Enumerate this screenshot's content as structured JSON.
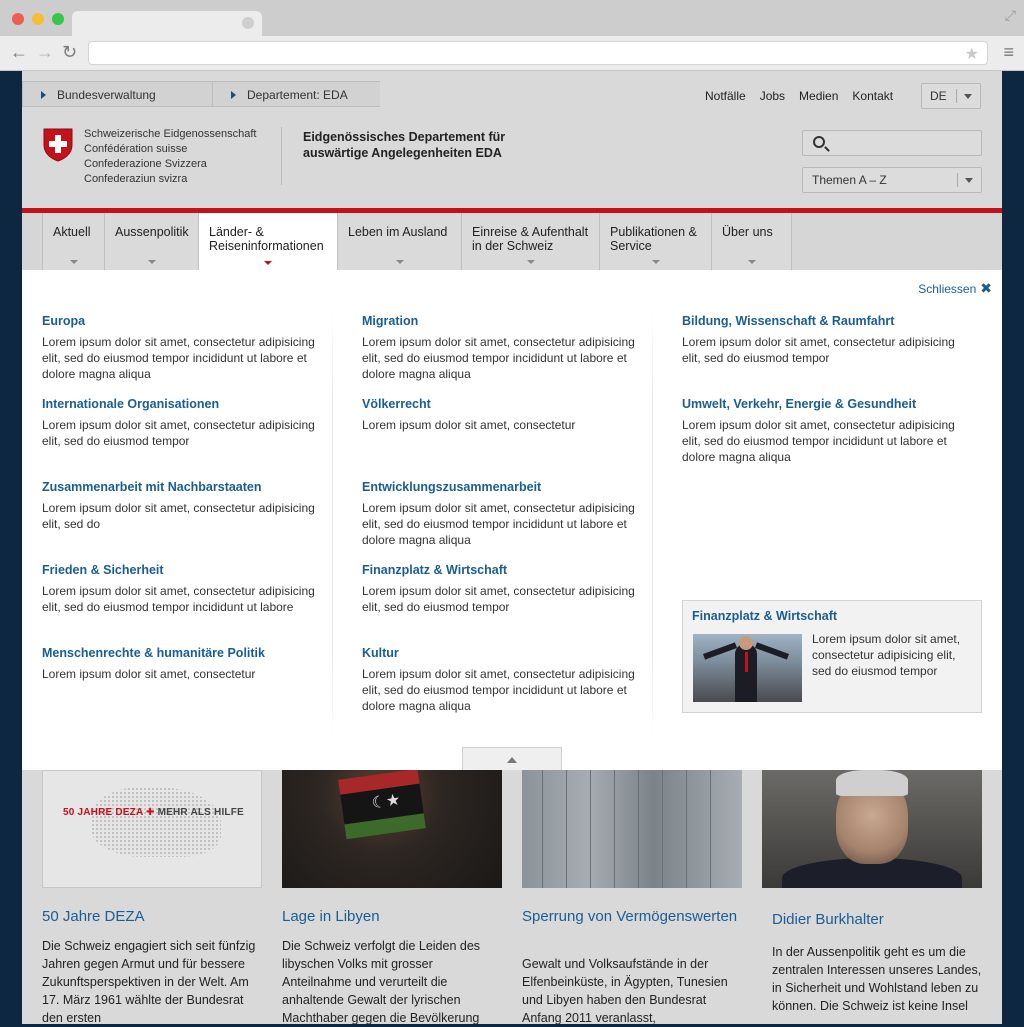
{
  "browser": {
    "tab_title": "",
    "url": ""
  },
  "breadcrumb": [
    "Bundesverwaltung",
    "Departement: EDA"
  ],
  "top_links": [
    "Notfälle",
    "Jobs",
    "Medien",
    "Kontakt"
  ],
  "language": "DE",
  "org_lines": [
    "Schweizerische Eidgenossenschaft",
    "Confédération suisse",
    "Confederazione Svizzera",
    "Confederaziun svizra"
  ],
  "department": [
    "Eidgenössisches Departement für",
    "auswärtige Angelegenheiten EDA"
  ],
  "search": {
    "placeholder": ""
  },
  "themen": "Themen A – Z",
  "nav": [
    {
      "l1": "Aktuell",
      "l2": ""
    },
    {
      "l1": "Aussenpolitik",
      "l2": ""
    },
    {
      "l1": "Länder- &",
      "l2": "Reiseninformationen"
    },
    {
      "l1": "Leben im Ausland",
      "l2": ""
    },
    {
      "l1": "Einreise & Aufenthalt",
      "l2": "in der Schweiz"
    },
    {
      "l1": "Publikationen &",
      "l2": "Service"
    },
    {
      "l1": "Über uns",
      "l2": ""
    }
  ],
  "dropdown": {
    "close_label": "Schliessen",
    "col1": [
      {
        "title": "Europa",
        "text": "Lorem ipsum dolor sit amet, consectetur adipisicing elit, sed do eiusmod tempor incididunt ut labore et dolore magna aliqua"
      },
      {
        "title": "Internationale Organisationen",
        "text": "Lorem ipsum dolor sit amet, consectetur adipisicing elit, sed do eiusmod tempor"
      },
      {
        "title": "Zusammenarbeit mit Nachbarstaaten",
        "text": "Lorem ipsum dolor sit amet, consectetur adipisicing elit, sed do"
      },
      {
        "title": "Frieden & Sicherheit",
        "text": "Lorem ipsum dolor sit amet, consectetur adipisicing elit, sed do eiusmod tempor incididunt ut labore"
      },
      {
        "title": "Menschenrechte & humanitäre Politik",
        "text": "Lorem ipsum dolor sit amet, consectetur"
      }
    ],
    "col2": [
      {
        "title": "Migration",
        "text": "Lorem ipsum dolor sit amet, consectetur adipisicing elit, sed do eiusmod tempor incididunt ut labore et dolore magna aliqua"
      },
      {
        "title": "Völkerrecht",
        "text": "Lorem ipsum dolor sit amet, consectetur"
      },
      {
        "title": "Entwicklungszusammenarbeit",
        "text": "Lorem ipsum dolor sit amet, consectetur adipisicing elit, sed do eiusmod tempor incididunt ut labore et dolore magna aliqua"
      },
      {
        "title": "Finanzplatz & Wirtschaft",
        "text": "Lorem ipsum dolor sit amet, consectetur adipisicing elit, sed do eiusmod tempor"
      },
      {
        "title": "Kultur",
        "text": "Lorem ipsum dolor sit amet, consectetur adipisicing elit, sed do eiusmod tempor incididunt ut labore et dolore magna aliqua"
      }
    ],
    "col3": [
      {
        "title": "Bildung, Wissenschaft & Raumfahrt",
        "text": "Lorem ipsum dolor sit amet, consectetur adipisicing elit, sed do eiusmod tempor"
      },
      {
        "title": "Umwelt, Verkehr, Energie & Gesundheit",
        "text": "Lorem ipsum dolor sit amet, consectetur adipisicing elit, sed do eiusmod tempor incididunt ut labore et dolore magna aliqua"
      }
    ],
    "teaser": {
      "title": "Finanzplatz & Wirtschaft",
      "text": "Lorem ipsum dolor sit amet, consectetur adipisicing elit, sed do eiusmod tempor"
    }
  },
  "cards": [
    {
      "title": "50 Jahre DEZA",
      "text": "Die Schweiz engagiert sich seit fünfzig Jahren gegen Armut und für bessere Zukunftsperspektiven in der Welt. Am 17. März 1961 wählte der Bundesrat den ersten",
      "image_text_red": "50 JAHRE DEZA",
      "image_text_dark": "MEHR ALS HILFE"
    },
    {
      "title": "Lage in Libyen",
      "text": "Die Schweiz verfolgt die Leiden des libyschen Volks mit grosser Anteilnahme und verurteilt die anhaltende Gewalt der lyrischen Machthaber gegen die Bevölkerung"
    },
    {
      "title": "Sperrung von Vermögenswerten",
      "text": "Gewalt und Volksaufstände in der Elfenbeinküste, in Ägypten, Tunesien und Libyen haben den Bundesrat Anfang 2011 veranlasst,"
    },
    {
      "title": "Didier Burkhalter",
      "text": "In der Aussenpolitik geht es um die zentralen Interessen unseres Landes, in Sicherheit und Wohlstand leben zu können. Die Schweiz ist keine Insel"
    }
  ],
  "colors": {
    "accent_red": "#c4111a",
    "link_blue": "#1a5d94"
  }
}
